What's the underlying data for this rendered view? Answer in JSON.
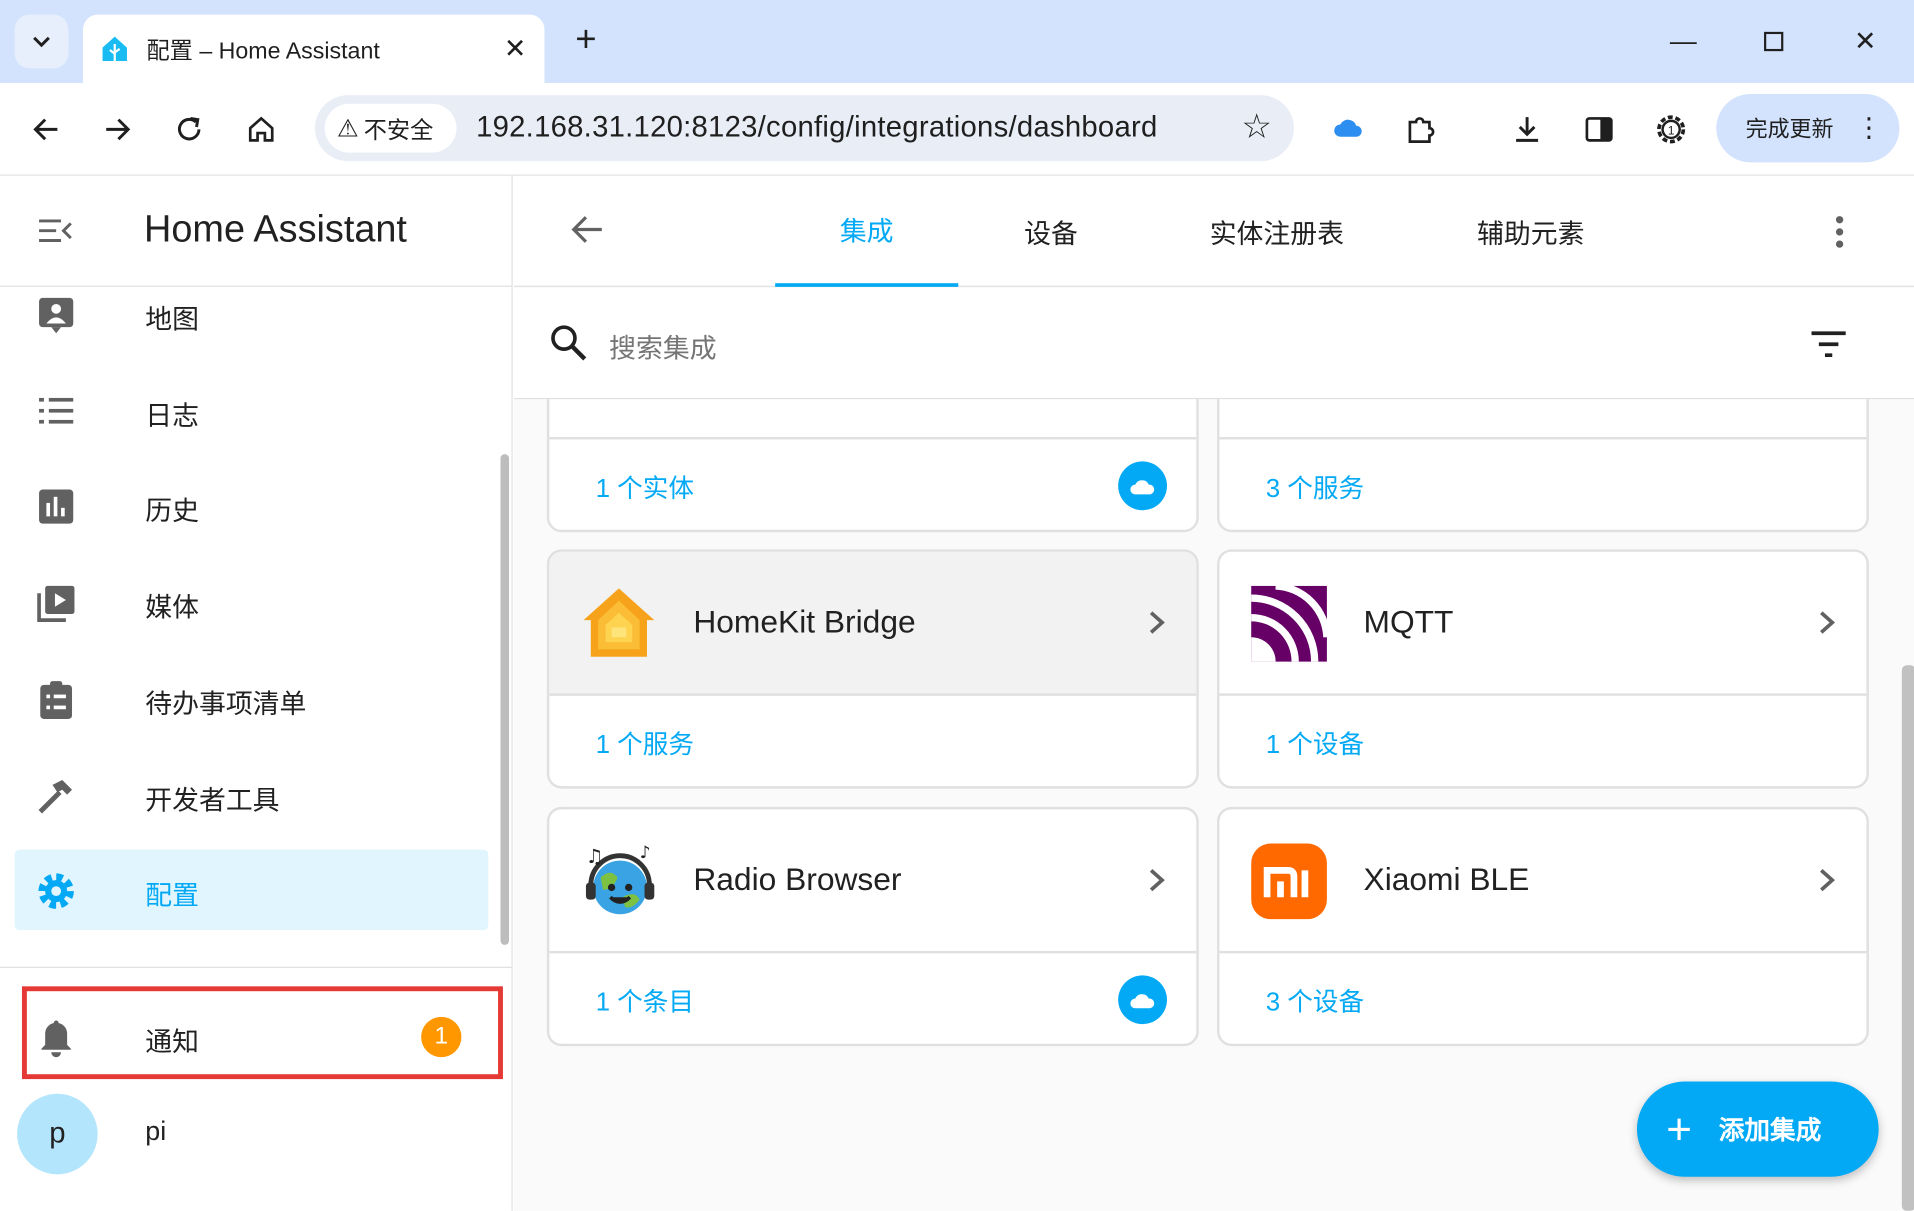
{
  "browser": {
    "tab_title": "配置 – Home Assistant",
    "new_tab": "+",
    "security_label": "不安全",
    "url": "192.168.31.120:8123/config/integrations/dashboard",
    "update_label": "完成更新"
  },
  "sidebar": {
    "brand": "Home Assistant",
    "items": [
      {
        "label": "地图",
        "icon": "map-icon"
      },
      {
        "label": "日志",
        "icon": "logbook-icon"
      },
      {
        "label": "历史",
        "icon": "history-icon"
      },
      {
        "label": "媒体",
        "icon": "media-icon"
      },
      {
        "label": "待办事项清单",
        "icon": "todo-icon"
      },
      {
        "label": "开发者工具",
        "icon": "hammer-icon"
      },
      {
        "label": "配置",
        "icon": "gear-icon"
      }
    ],
    "notifications": {
      "label": "通知",
      "count": "1"
    },
    "user": {
      "initial": "p",
      "name": "pi"
    }
  },
  "main": {
    "tabs": [
      "集成",
      "设备",
      "实体注册表",
      "辅助元素"
    ],
    "active_tab": "集成",
    "search_placeholder": "搜索集成",
    "cards": [
      {
        "name": "",
        "footer": "1 个实体",
        "cloud": true
      },
      {
        "name": "",
        "footer": "3 个服务",
        "cloud": false
      },
      {
        "name": "HomeKit Bridge",
        "footer": "1 个服务",
        "cloud": false
      },
      {
        "name": "MQTT",
        "footer": "1 个设备",
        "cloud": false
      },
      {
        "name": "Radio Browser",
        "footer": "1 个条目",
        "cloud": true
      },
      {
        "name": "Xiaomi BLE",
        "footer": "3 个设备",
        "cloud": false
      }
    ],
    "fab_label": "添加集成"
  },
  "colors": {
    "accent": "#03a9f4",
    "badge": "#ff9800",
    "highlight_box": "#e53935",
    "mqtt": "#660066",
    "xiaomi": "#ff6900"
  }
}
